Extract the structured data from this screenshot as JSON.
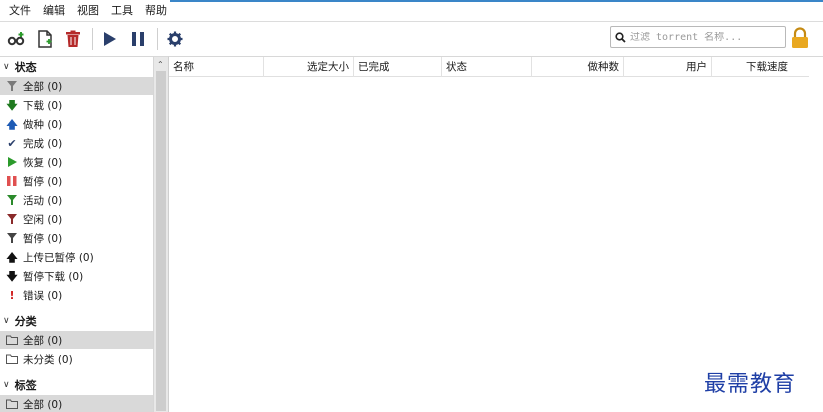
{
  "menu": [
    "文件",
    "编辑",
    "视图",
    "工具",
    "帮助"
  ],
  "search": {
    "placeholder": "过滤 torrent 名称..."
  },
  "sidebar": {
    "status_title": "状态",
    "status_items": [
      {
        "label": "全部 (0)",
        "icon": "filter-icon"
      },
      {
        "label": "下载 (0)",
        "icon": "arrow-down-icon"
      },
      {
        "label": "做种 (0)",
        "icon": "arrow-up-icon"
      },
      {
        "label": "完成 (0)",
        "icon": "check-icon"
      },
      {
        "label": "恢复 (0)",
        "icon": "play-icon"
      },
      {
        "label": "暂停 (0)",
        "icon": "pause-icon"
      },
      {
        "label": "活动 (0)",
        "icon": "filter-icon"
      },
      {
        "label": "空闲 (0)",
        "icon": "filter-icon"
      },
      {
        "label": "暂停 (0)",
        "icon": "filter-icon"
      },
      {
        "label": "上传已暂停 (0)",
        "icon": "arrow-up-icon"
      },
      {
        "label": "暂停下载 (0)",
        "icon": "arrow-down-icon"
      },
      {
        "label": "错误 (0)",
        "icon": "error-icon"
      }
    ],
    "category_title": "分类",
    "category_items": [
      {
        "label": "全部 (0)",
        "icon": "folder-icon"
      },
      {
        "label": "未分类 (0)",
        "icon": "folder-icon"
      }
    ],
    "tags_title": "标签",
    "tag_items": [
      {
        "label": "全部 (0)",
        "icon": "folder-icon"
      }
    ]
  },
  "table": {
    "columns": [
      "名称",
      "选定大小",
      "已完成",
      "状态",
      "做种数",
      "用户",
      "下载速度"
    ]
  },
  "watermark": "最需教育",
  "colors": {
    "accent": "#3a86c8",
    "play": "#2b9a2b",
    "pause": "#e05050",
    "download": "#1f7a1f",
    "upload": "#1e5bb5",
    "error": "#d12020"
  }
}
